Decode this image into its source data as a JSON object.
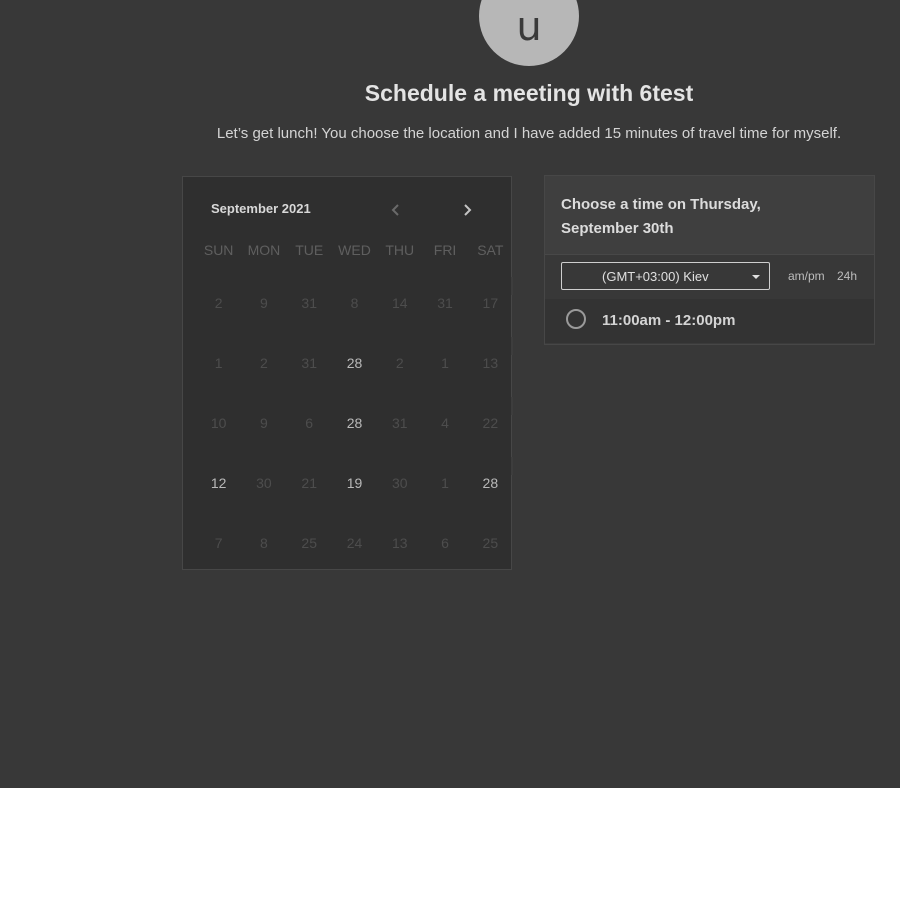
{
  "header": {
    "avatar_initial": "u",
    "title": "Schedule a meeting with 6test",
    "description": "Let’s get lunch! You choose the location and I have added 15 minutes of travel time for myself."
  },
  "calendar": {
    "month_label": "September 2021",
    "prev_icon": "chevron-left-icon",
    "next_icon": "chevron-right-icon",
    "weekdays": [
      "SUN",
      "MON",
      "TUE",
      "WED",
      "THU",
      "FRI",
      "SAT"
    ],
    "weeks": [
      [
        {
          "d": "2",
          "a": false
        },
        {
          "d": "9",
          "a": false
        },
        {
          "d": "31",
          "a": false
        },
        {
          "d": "8",
          "a": false
        },
        {
          "d": "14",
          "a": false
        },
        {
          "d": "31",
          "a": false
        },
        {
          "d": "17",
          "a": false
        }
      ],
      [
        {
          "d": "1",
          "a": false
        },
        {
          "d": "2",
          "a": false
        },
        {
          "d": "31",
          "a": false
        },
        {
          "d": "28",
          "a": true
        },
        {
          "d": "2",
          "a": false
        },
        {
          "d": "1",
          "a": false
        },
        {
          "d": "13",
          "a": false
        }
      ],
      [
        {
          "d": "10",
          "a": false
        },
        {
          "d": "9",
          "a": false
        },
        {
          "d": "6",
          "a": false
        },
        {
          "d": "28",
          "a": true
        },
        {
          "d": "31",
          "a": false
        },
        {
          "d": "4",
          "a": false
        },
        {
          "d": "22",
          "a": false
        }
      ],
      [
        {
          "d": "12",
          "a": true
        },
        {
          "d": "30",
          "a": false
        },
        {
          "d": "21",
          "a": false
        },
        {
          "d": "19",
          "a": true
        },
        {
          "d": "30",
          "a": false
        },
        {
          "d": "1",
          "a": false
        },
        {
          "d": "28",
          "a": true
        }
      ],
      [
        {
          "d": "7",
          "a": false
        },
        {
          "d": "8",
          "a": false
        },
        {
          "d": "25",
          "a": false
        },
        {
          "d": "24",
          "a": false
        },
        {
          "d": "13",
          "a": false
        },
        {
          "d": "6",
          "a": false
        },
        {
          "d": "25",
          "a": false
        }
      ]
    ]
  },
  "time_panel": {
    "title": "Choose a time on Thursday, September 30th",
    "timezone": "(GMT+03:00) Kiev",
    "format_ampm": "am/pm",
    "format_24": "24h",
    "slots": [
      {
        "label": "11:00am - 12:00pm"
      }
    ]
  },
  "colors": {
    "page_background": "#383838",
    "avatar": "#b7b7b7",
    "calendar_background": "#2f2f2f"
  }
}
